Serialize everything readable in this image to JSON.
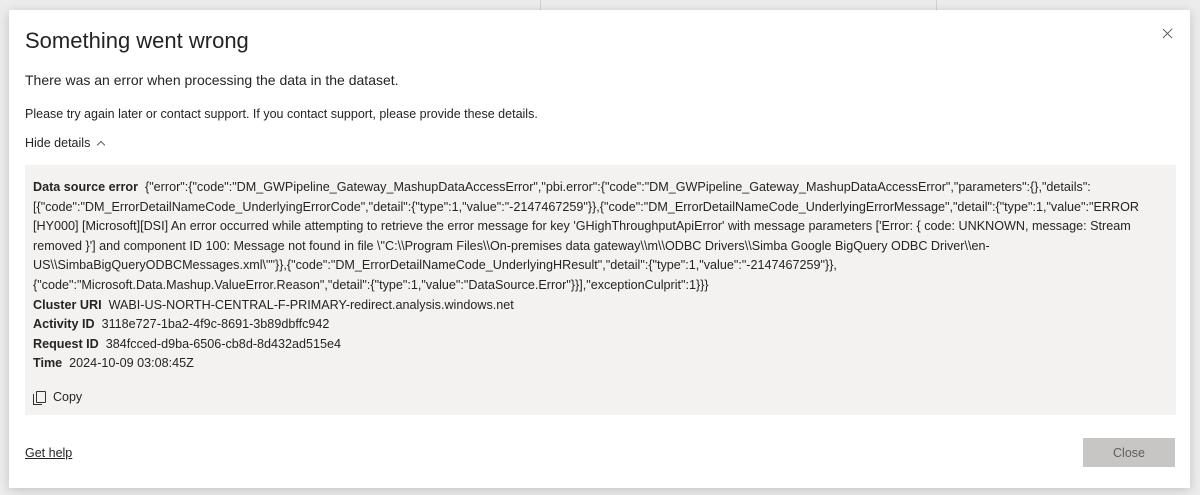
{
  "dialog": {
    "title": "Something went wrong",
    "message": "There was an error when processing the data in the dataset.",
    "instructions": "Please try again later or contact support. If you contact support, please provide these details.",
    "toggle_label": "Hide details",
    "copy_label": "Copy",
    "help_link": "Get help",
    "close_label": "Close"
  },
  "details": {
    "data_source_error": {
      "label": "Data source error",
      "value": "{\"error\":{\"code\":\"DM_GWPipeline_Gateway_MashupDataAccessError\",\"pbi.error\":{\"code\":\"DM_GWPipeline_Gateway_MashupDataAccessError\",\"parameters\":{},\"details\":[{\"code\":\"DM_ErrorDetailNameCode_UnderlyingErrorCode\",\"detail\":{\"type\":1,\"value\":\"-2147467259\"}},{\"code\":\"DM_ErrorDetailNameCode_UnderlyingErrorMessage\",\"detail\":{\"type\":1,\"value\":\"ERROR [HY000] [Microsoft][DSI] An error occurred while attempting to retrieve the error message for key 'GHighThroughputApiError' with message parameters ['Error: { code: UNKNOWN, message: Stream removed }'] and component ID 100: Message not found in file \\\"C:\\\\Program Files\\\\On-premises data gateway\\\\m\\\\ODBC Drivers\\\\Simba Google BigQuery ODBC Driver\\\\en-US\\\\SimbaBigQueryODBCMessages.xml\\\"\"}},{\"code\":\"DM_ErrorDetailNameCode_UnderlyingHResult\",\"detail\":{\"type\":1,\"value\":\"-2147467259\"}},{\"code\":\"Microsoft.Data.Mashup.ValueError.Reason\",\"detail\":{\"type\":1,\"value\":\"DataSource.Error\"}}],\"exceptionCulprit\":1}}}"
    },
    "cluster_uri": {
      "label": "Cluster URI",
      "value": "WABI-US-NORTH-CENTRAL-F-PRIMARY-redirect.analysis.windows.net"
    },
    "activity_id": {
      "label": "Activity ID",
      "value": "3118e727-1ba2-4f9c-8691-3b89dbffc942"
    },
    "request_id": {
      "label": "Request ID",
      "value": "384fcced-d9ba-6506-cb8d-8d432ad515e4"
    },
    "time": {
      "label": "Time",
      "value": "2024-10-09 03:08:45Z"
    }
  },
  "icons": {
    "close": "close-icon",
    "chevron": "chevron-up-icon",
    "copy": "copy-icon"
  },
  "colors": {
    "details_bg": "#f3f2f1",
    "close_button_bg": "#c8c6c4"
  }
}
